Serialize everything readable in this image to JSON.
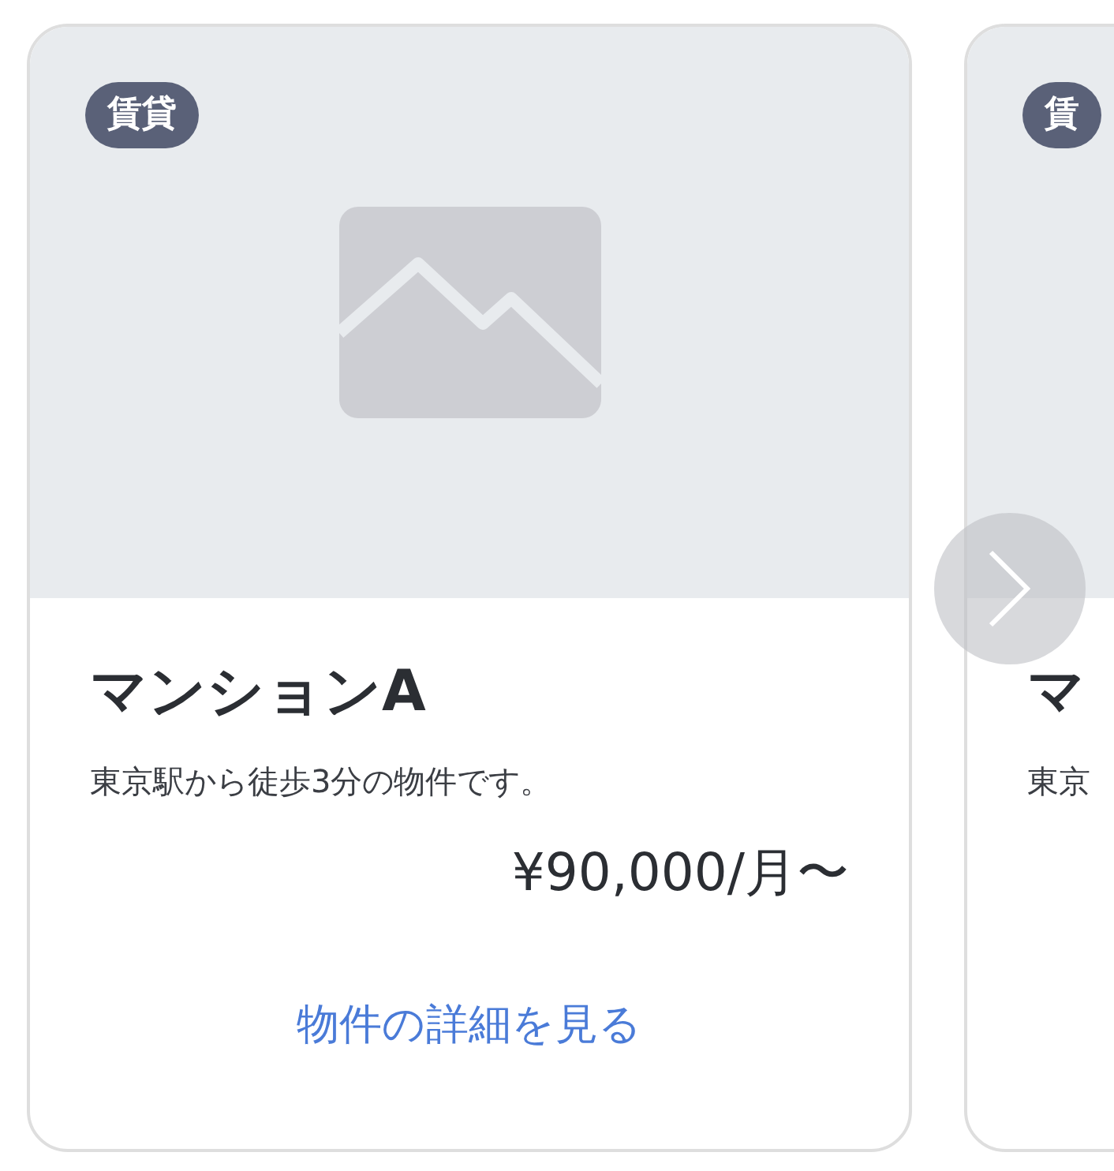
{
  "listings": [
    {
      "kind": "full",
      "badge": "賃貸",
      "title": "マンションA",
      "description": "東京駅から徒歩3分の物件です。",
      "price": "¥90,000/月〜",
      "link": "物件の詳細を見る"
    },
    {
      "kind": "peek",
      "badge": "賃",
      "title": "マ",
      "description": "東京"
    }
  ]
}
